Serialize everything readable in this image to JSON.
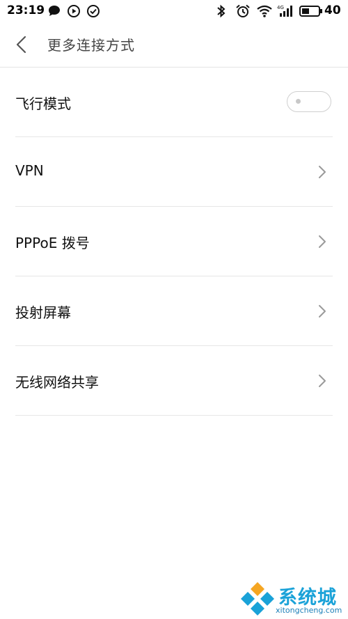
{
  "status_bar": {
    "time": "23:19",
    "battery": "40",
    "icons": [
      "chat-bubble-icon",
      "play-circle-icon",
      "check-circle-icon",
      "bluetooth-icon",
      "alarm-icon",
      "wifi-icon",
      "signal-4g-icon",
      "battery-icon"
    ]
  },
  "header": {
    "title": "更多连接方式",
    "back_icon": "chevron-left-icon"
  },
  "items": [
    {
      "label": "飞行模式",
      "control": "toggle",
      "toggle_on": false
    },
    {
      "label": "VPN",
      "control": "chevron"
    },
    {
      "label": "PPPoE 拨号",
      "control": "chevron"
    },
    {
      "label": "投射屏幕",
      "control": "chevron"
    },
    {
      "label": "无线网络共享",
      "control": "chevron"
    }
  ],
  "watermark": {
    "text": "系统城",
    "url": "xitongcheng.com"
  },
  "colors": {
    "text": "#111111",
    "divider": "#e6e6e6",
    "chevron": "#9a9a9a",
    "watermark_blue": "#1aa2d8"
  }
}
